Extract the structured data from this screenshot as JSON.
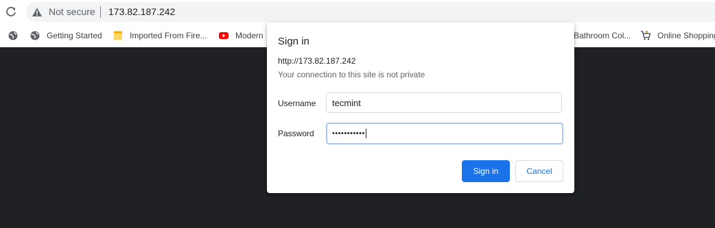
{
  "browser": {
    "security_label": "Not secure",
    "url": "173.82.187.242",
    "icons": {
      "reload": "reload-icon",
      "warning": "warning-icon"
    }
  },
  "bookmarks": [
    {
      "label": "",
      "icon": "globe-icon"
    },
    {
      "label": "Getting Started",
      "icon": "globe-icon"
    },
    {
      "label": "Imported From Fire...",
      "icon": "folder-icon"
    },
    {
      "label": "Modern",
      "icon": "youtube-icon"
    },
    {
      "label": "Bathroom Col...",
      "icon": "globe-icon"
    },
    {
      "label": "Online Shopping",
      "icon": "shopping-cart-icon"
    }
  ],
  "dialog": {
    "title": "Sign in",
    "origin": "http://173.82.187.242",
    "message": "Your connection to this site is not private",
    "username_label": "Username",
    "username_value": "tecmint",
    "password_label": "Password",
    "password_mask": "•••••••••••",
    "sign_in_label": "Sign in",
    "cancel_label": "Cancel"
  },
  "colors": {
    "accent": "#1a73e8",
    "page_background": "#202124",
    "focus_ring": "#a8c7fa"
  }
}
